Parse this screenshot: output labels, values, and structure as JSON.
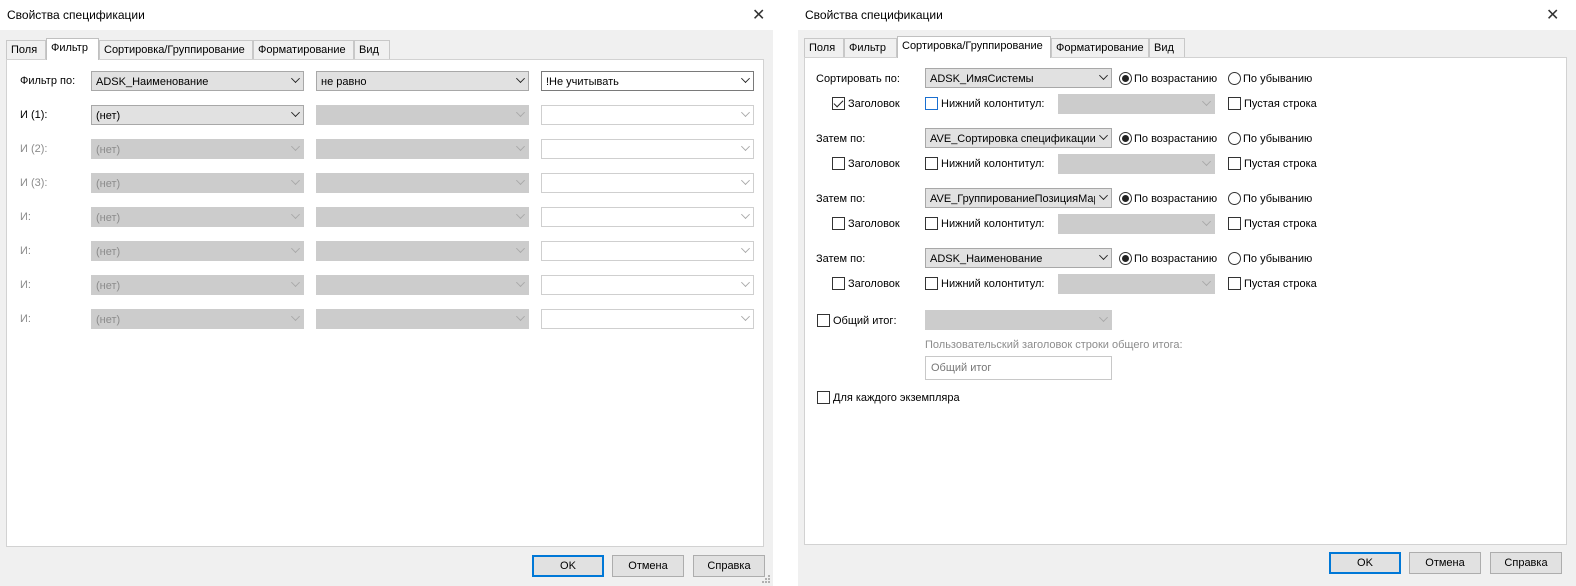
{
  "filter_dialog": {
    "title": "Свойства спецификации",
    "tabs": [
      "Поля",
      "Фильтр",
      "Сортировка/Группирование",
      "Форматирование",
      "Вид"
    ],
    "active_tab": "Фильтр",
    "rows": [
      {
        "label": "Фильтр по:",
        "field": "ADSK_Наименование",
        "condition": "не равно",
        "value": "!Не учитывать",
        "state": "active"
      },
      {
        "label": "И (1):",
        "field": "(нет)",
        "condition": "",
        "value": "",
        "state": "partial"
      },
      {
        "label": "И (2):",
        "field": "(нет)",
        "condition": "",
        "value": "",
        "state": "disabled"
      },
      {
        "label": "И (3):",
        "field": "(нет)",
        "condition": "",
        "value": "",
        "state": "disabled"
      },
      {
        "label": "И:",
        "field": "(нет)",
        "condition": "",
        "value": "",
        "state": "disabled"
      },
      {
        "label": "И:",
        "field": "(нет)",
        "condition": "",
        "value": "",
        "state": "disabled"
      },
      {
        "label": "И:",
        "field": "(нет)",
        "condition": "",
        "value": "",
        "state": "disabled"
      },
      {
        "label": "И:",
        "field": "(нет)",
        "condition": "",
        "value": "",
        "state": "disabled"
      }
    ],
    "buttons": {
      "ok": "OK",
      "cancel": "Отмена",
      "help": "Справка"
    }
  },
  "sort_dialog": {
    "title": "Свойства спецификации",
    "tabs": [
      "Поля",
      "Фильтр",
      "Сортировка/Группирование",
      "Форматирование",
      "Вид"
    ],
    "active_tab": "Сортировка/Группирование",
    "groups": [
      {
        "label": "Сортировать по:",
        "field": "ADSK_ИмяСистемы",
        "ascending": "По возрастанию",
        "descending": "По убыванию",
        "order": "ascending",
        "header": "Заголовок",
        "header_checked": true,
        "footer": "Нижний колонтитул:",
        "footer_checked": false,
        "blank_line": "Пустая строка",
        "blank_checked": false
      },
      {
        "label": "Затем по:",
        "field": "AVE_Сортировка спецификации",
        "ascending": "По возрастанию",
        "descending": "По убыванию",
        "order": "ascending",
        "header": "Заголовок",
        "header_checked": false,
        "footer": "Нижний колонтитул:",
        "footer_checked": false,
        "blank_line": "Пустая строка",
        "blank_checked": false
      },
      {
        "label": "Затем по:",
        "field": "AVE_ГруппированиеПозицияМар",
        "ascending": "По возрастанию",
        "descending": "По убыванию",
        "order": "ascending",
        "header": "Заголовок",
        "header_checked": false,
        "footer": "Нижний колонтитул:",
        "footer_checked": false,
        "blank_line": "Пустая строка",
        "blank_checked": false
      },
      {
        "label": "Затем по:",
        "field": "ADSK_Наименование",
        "ascending": "По возрастанию",
        "descending": "По убыванию",
        "order": "ascending",
        "header": "Заголовок",
        "header_checked": false,
        "footer": "Нижний колонтитул:",
        "footer_checked": false,
        "blank_line": "Пустая строка",
        "blank_checked": false
      }
    ],
    "grand_total": {
      "label": "Общий итог:",
      "checked": false,
      "caption_label": "Пользовательский заголовок строки общего итога:",
      "caption_value": "Общий итог"
    },
    "each_instance": {
      "label": "Для каждого экземпляра",
      "checked": false
    },
    "buttons": {
      "ok": "OK",
      "cancel": "Отмена",
      "help": "Справка"
    }
  }
}
